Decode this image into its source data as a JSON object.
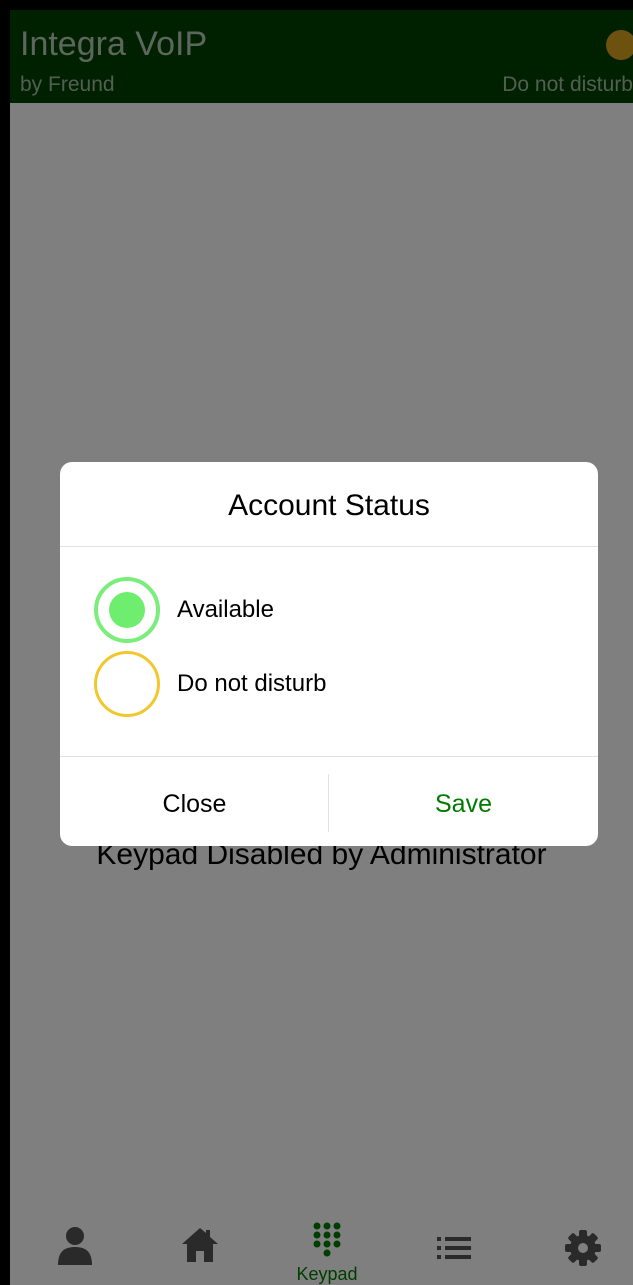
{
  "header": {
    "title": "Integra VoIP",
    "subtitle": "by Freund",
    "status_text": "Do not disturb",
    "status_color": "#d9a21f",
    "background_color": "#014201"
  },
  "main": {
    "message": "Keypad Disabled by Administrator"
  },
  "bottom_nav": {
    "items": [
      {
        "icon": "person-icon",
        "label": ""
      },
      {
        "icon": "home-icon",
        "label": ""
      },
      {
        "icon": "keypad-icon",
        "label": "Keypad",
        "active": true
      },
      {
        "icon": "list-icon",
        "label": ""
      },
      {
        "icon": "gear-icon",
        "label": ""
      }
    ],
    "active_color": "#007a00"
  },
  "dialog": {
    "title": "Account Status",
    "options": [
      {
        "label": "Available",
        "selected": true,
        "color": "#6eed6e"
      },
      {
        "label": "Do not disturb",
        "selected": false,
        "color": "#f1c72c"
      }
    ],
    "close_label": "Close",
    "save_label": "Save",
    "save_color": "#007a00"
  }
}
